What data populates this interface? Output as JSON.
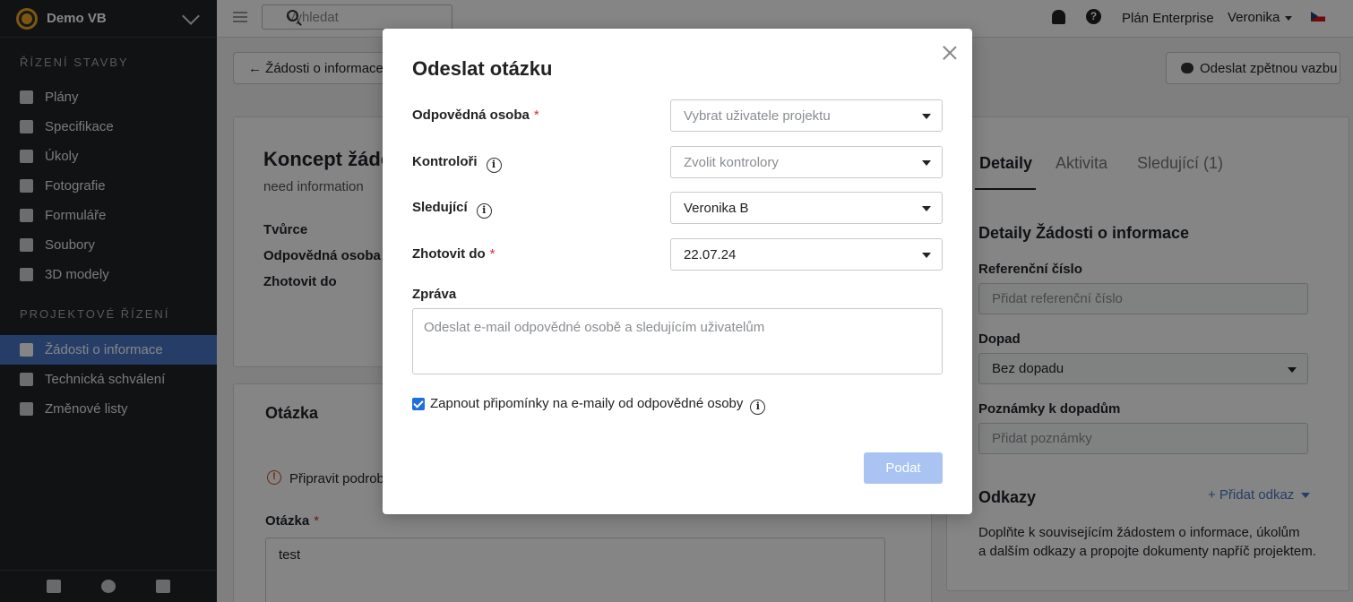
{
  "sidebar": {
    "project_name": "Demo VB",
    "section1": "ŘÍZENÍ STAVBY",
    "section2": "PROJEKTOVÉ ŘÍZENÍ",
    "items1": [
      {
        "label": "Plány",
        "icon": "plans-icon"
      },
      {
        "label": "Specifikace",
        "icon": "specifications-icon"
      },
      {
        "label": "Úkoly",
        "icon": "tasks-icon"
      },
      {
        "label": "Fotografie",
        "icon": "camera-icon"
      },
      {
        "label": "Formuláře",
        "icon": "forms-icon"
      },
      {
        "label": "Soubory",
        "icon": "paperclip-icon"
      },
      {
        "label": "3D modely",
        "icon": "cube-icon"
      }
    ],
    "items2": [
      {
        "label": "Žádosti o informace",
        "icon": "rfi-icon",
        "active": true
      },
      {
        "label": "Technická schválení",
        "icon": "user-icon"
      },
      {
        "label": "Změnové listy",
        "icon": "change-order-icon"
      }
    ],
    "footer_icons": [
      "people-icon",
      "gear-icon",
      "trash-icon"
    ]
  },
  "topbar": {
    "search_placeholder": "Vyhledat",
    "plan": "Plán Enterprise",
    "user": "Veronika"
  },
  "page": {
    "back_label": "Žádosti o informace",
    "feedback_label": "Odeslat zpětnou vazbu",
    "draft_title": "Koncept žádo",
    "draft_subtitle": "need information",
    "meta_labels": [
      "Tvůrce",
      "Odpovědná osoba",
      "Zhotovit do"
    ],
    "question_header": "Otázka",
    "prepare_text": "Připravit podrobn",
    "question_label": "Otázka",
    "question_value": "test",
    "tabs": [
      "Detaily",
      "Aktivita",
      "Sledující (1)"
    ],
    "details_title": "Detaily Žádosti o informace",
    "ref_label": "Referenční číslo",
    "ref_placeholder": "Přidat referenční číslo",
    "impact_label": "Dopad",
    "impact_value": "Bez dopadu",
    "impact_notes_label": "Poznámky k dopadům",
    "impact_notes_placeholder": "Přidat poznámky",
    "links_title": "Odkazy",
    "add_link": "+ Přidat odkaz",
    "links_desc1": "Doplňte k souvisejícím žádostem o informace, úkolům",
    "links_desc2": "a dalším odkazy a propojte dokumenty napříč projektem."
  },
  "modal": {
    "title": "Odeslat otázku",
    "responsible_label": "Odpovědná osoba",
    "responsible_placeholder": "Vybrat uživatele projektu",
    "reviewers_label": "Kontroloři",
    "reviewers_placeholder": "Zvolit kontrolory",
    "followers_label": "Sledující",
    "followers_value": "Veronika B",
    "due_label": "Zhotovit do",
    "due_value": "22.07.24",
    "message_label": "Zpráva",
    "message_placeholder": "Odeslat e-mail odpovědné osobě a sledujícím uživatelům",
    "reminder_label": "Zapnout připomínky na e-maily od odpovědné osoby",
    "reminder_checked": true,
    "submit_label": "Podat",
    "required_mark": "*",
    "info_mark": "i"
  }
}
